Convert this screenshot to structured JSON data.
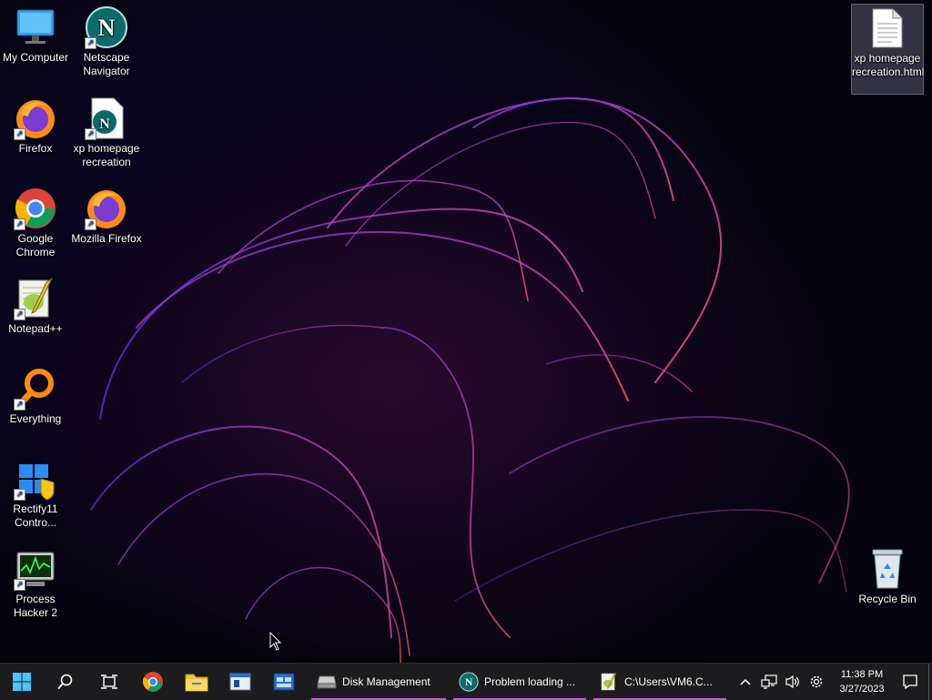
{
  "desktop": {
    "left_icons": [
      {
        "label": "My Computer"
      },
      {
        "label": "Netscape Navigator"
      },
      {
        "label": "Firefox"
      },
      {
        "label": "xp homepage recreation"
      },
      {
        "label": "Google Chrome"
      },
      {
        "label": "Mozilla Firefox"
      },
      {
        "label": "Notepad++"
      },
      {
        "label": "Everything"
      },
      {
        "label": "Rectify11 Contro..."
      },
      {
        "label": "Process Hacker 2"
      }
    ],
    "right_icons": [
      {
        "label": "xp homepage recreation.html"
      },
      {
        "label": "Recycle Bin"
      }
    ]
  },
  "taskbar": {
    "apps": [
      {
        "label": "Disk Management"
      },
      {
        "label": "Problem loading ..."
      },
      {
        "label": "C:\\Users\\VM6.C..."
      }
    ],
    "clock": {
      "time": "11:38 PM",
      "date": "3/27/2023"
    },
    "accent_color": "#c45bd8",
    "background_color": "#1c1c1e"
  }
}
